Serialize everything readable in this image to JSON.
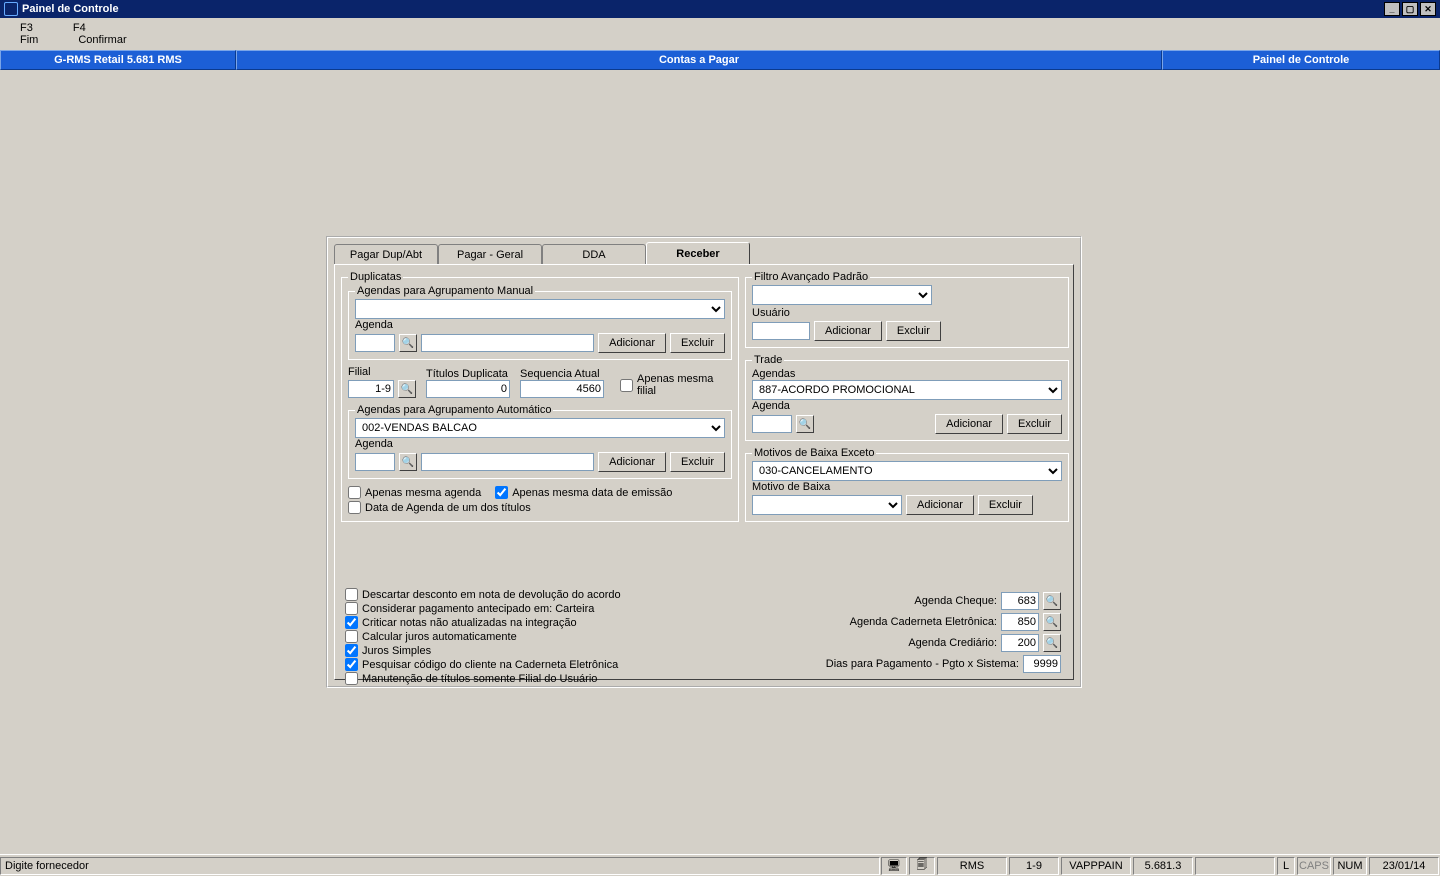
{
  "window": {
    "title": "Painel de Controle"
  },
  "menu": {
    "f3": "F3",
    "f4": "F4",
    "fim": "Fim",
    "confirmar": "Confirmar"
  },
  "bluebar": {
    "left": "G-RMS Retail 5.681 RMS",
    "center": "Contas a Pagar",
    "right": "Painel de Controle"
  },
  "tabs": {
    "t1": "Pagar Dup/Abt",
    "t2": "Pagar - Geral",
    "t3": "DDA",
    "t4": "Receber"
  },
  "dup": {
    "legend": "Duplicatas",
    "agrup_manual_legend": "Agendas para Agrupamento Manual",
    "agenda_label": "Agenda",
    "adicionar": "Adicionar",
    "excluir": "Excluir",
    "filial_label": "Filial",
    "filial_value": "1-9",
    "titulos_label": "Títulos Duplicata",
    "titulos_value": "0",
    "seq_label": "Sequencia Atual",
    "seq_value": "4560",
    "apenas_filial": "Apenas mesma filial",
    "agrup_auto_legend": "Agendas para Agrupamento Automático",
    "agrup_auto_value": "002-VENDAS BALCAO",
    "apenas_agenda": "Apenas mesma agenda",
    "apenas_data": "Apenas mesma data de emissão",
    "data_agenda": "Data de Agenda de um dos títulos"
  },
  "filtro": {
    "legend": "Filtro Avançado Padrão",
    "usuario_label": "Usuário",
    "adicionar": "Adicionar",
    "excluir": "Excluir"
  },
  "trade": {
    "legend": "Trade",
    "agendas_label": "Agendas",
    "agendas_value": "887-ACORDO PROMOCIONAL",
    "agenda_label": "Agenda",
    "adicionar": "Adicionar",
    "excluir": "Excluir"
  },
  "motivos": {
    "legend": "Motivos de Baixa Exceto",
    "value": "030-CANCELAMENTO",
    "motivo_label": "Motivo de Baixa",
    "adicionar": "Adicionar",
    "excluir": "Excluir"
  },
  "checks": {
    "c1": "Descartar desconto em nota de devolução do acordo",
    "c2": "Considerar pagamento antecipado em: Carteira",
    "c3": "Criticar notas não atualizadas na integração",
    "c4": "Calcular juros automaticamente",
    "c5": "Juros Simples",
    "c6": "Pesquisar código do cliente na Caderneta Eletrônica",
    "c7": "Manutenção de títulos somente Filial do Usuário"
  },
  "rvals": {
    "l1": "Agenda Cheque:",
    "v1": "683",
    "l2": "Agenda Caderneta Eletrônica:",
    "v2": "850",
    "l3": "Agenda Crediário:",
    "v3": "200",
    "l4": "Dias para Pagamento - Pgto x Sistema:",
    "v4": "9999"
  },
  "status": {
    "hint": "Digite fornecedor",
    "s1": "RMS",
    "s2": "1-9",
    "s3": "VAPPPAIN",
    "s4": "5.681.3",
    "sL": "L",
    "sCaps": "CAPS",
    "sNum": "NUM",
    "date": "23/01/14"
  }
}
